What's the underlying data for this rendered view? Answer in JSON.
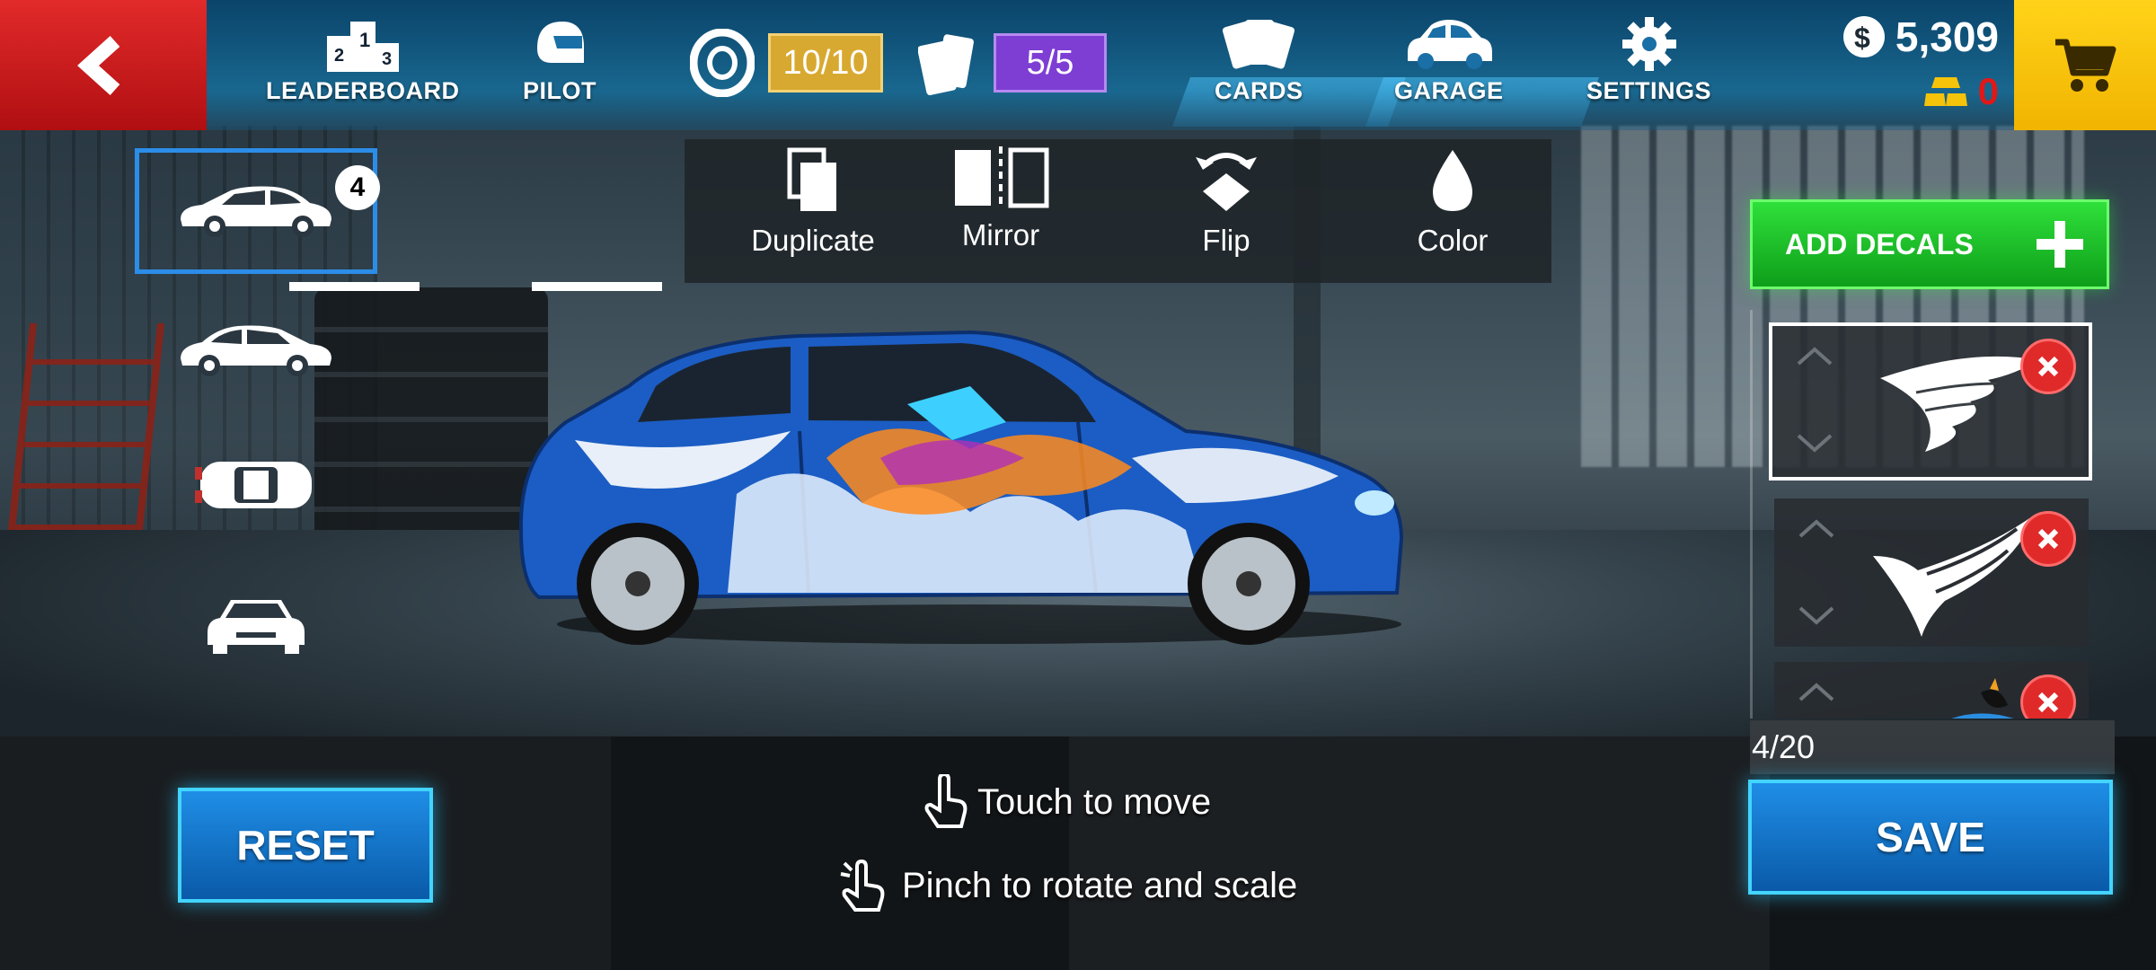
{
  "topbar": {
    "nav": {
      "leaderboard": "LEADERBOARD",
      "pilot": "PILOT",
      "cards": "CARDS",
      "garage": "GARAGE",
      "settings": "SETTINGS"
    },
    "tires_counter": "10/10",
    "tickets_counter": "5/5",
    "money": "5,309",
    "gold": "0"
  },
  "views": {
    "selected_badge": "4"
  },
  "tools": {
    "duplicate": "Duplicate",
    "mirror": "Mirror",
    "flip": "Flip",
    "color": "Color"
  },
  "decals": {
    "add_label": "ADD DECALS",
    "count": "4/20"
  },
  "actions": {
    "reset": "RESET",
    "save": "SAVE"
  },
  "hints": {
    "move": "Touch to move",
    "rotate": "Pinch to rotate and scale"
  },
  "colors": {
    "back_red": "#d01a1c",
    "cart_yellow": "#f5c30a",
    "decal_green": "#1fbf2a",
    "save_blue": "#1577cc",
    "selected_outline": "#2c8de8"
  }
}
